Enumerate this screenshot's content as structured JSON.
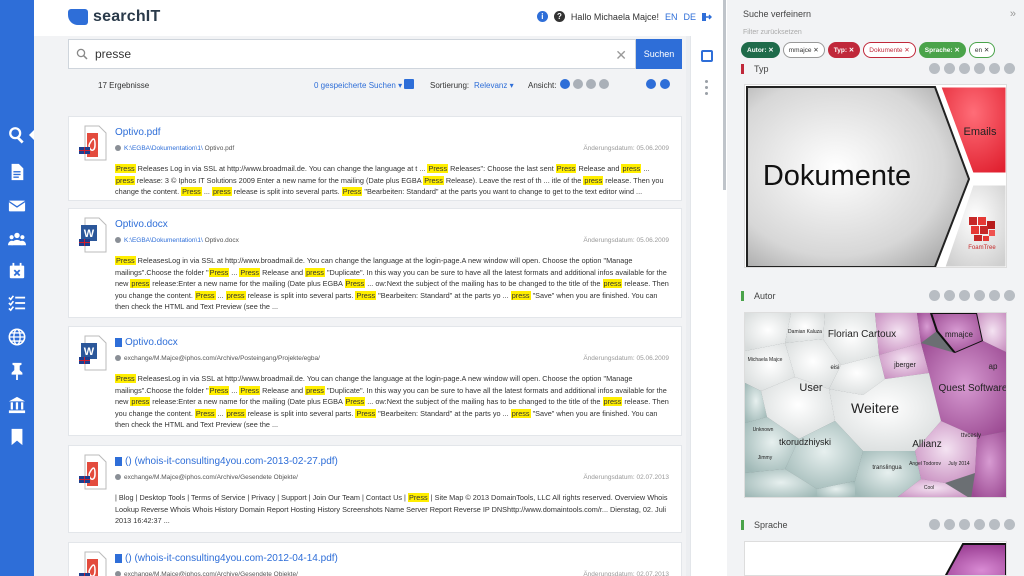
{
  "app": {
    "name": "searchIT"
  },
  "header": {
    "greeting": "Hallo Michaela Majce!",
    "lang_en": "EN",
    "lang_de": "DE",
    "info_icon": "info-icon",
    "help_icon": "help-icon",
    "logout_icon": "logout-icon"
  },
  "nav": {
    "items": [
      "search-icon",
      "document-icon",
      "mail-icon",
      "users-icon",
      "calendar-icon",
      "checklist-icon",
      "globe-icon",
      "pin-icon",
      "bank-icon",
      "bookmark-icon"
    ],
    "active_index": 0,
    "accent_color": "#2e6ed8"
  },
  "search": {
    "query": "presse",
    "button_label": "Suchen"
  },
  "results_bar": {
    "count": "17 Ergebnisse",
    "saved_searches": "0 gespeicherte Suchen",
    "sort_label": "Sortierung:",
    "sort_value": "Relevanz",
    "view_label": "Ansicht:"
  },
  "results": [
    {
      "title": "Optivo.pdf",
      "type": "pdf",
      "path_link": "K:\\EGBA\\Dokumentation\\1\\",
      "path_file": "Optivo.pdf",
      "date": "Änderungsdatum: 05.06.2009",
      "snippet": [
        [
          "m",
          "Press"
        ],
        [
          "t",
          " Releases Log in via SSL at http://www.broadmail.de. You can change the language at t ... "
        ],
        [
          "m",
          "Press"
        ],
        [
          "t",
          " Releases\": Choose the last sent "
        ],
        [
          "m",
          "Press"
        ],
        [
          "t",
          " Release and "
        ],
        [
          "m",
          "press"
        ],
        [
          "t",
          " ... "
        ],
        [
          "m",
          "press"
        ],
        [
          "t",
          " release: 3 © Iphos IT Solutions 2009 Enter a new name for the mailing (Date plus EGBA "
        ],
        [
          "m",
          "Press"
        ],
        [
          "t",
          " Release). Leave the rest of th ... itle of the "
        ],
        [
          "m",
          "press"
        ],
        [
          "t",
          " release. Then you change the content. "
        ],
        [
          "m",
          "Press"
        ],
        [
          "t",
          " ... "
        ],
        [
          "m",
          "press"
        ],
        [
          "t",
          " release is split into several parts. "
        ],
        [
          "m",
          "Press"
        ],
        [
          "t",
          " \"Bearbeiten: Standard\" at the parts you want to change to get to the text editor wind ..."
        ]
      ]
    },
    {
      "title": "Optivo.docx",
      "type": "docx",
      "path_link": "K:\\EGBA\\Dokumentation\\1\\",
      "path_file": "Optivo.docx",
      "date": "Änderungsdatum: 05.06.2009",
      "snippet": [
        [
          "m",
          "Press"
        ],
        [
          "t",
          " ReleasesLog in via SSL at http://www.broadmail.de. You can change the language at the login-page.A new window will open. Choose the option \"Manage mailings\".Choose the folder \""
        ],
        [
          "m",
          "Press"
        ],
        [
          "t",
          " ... "
        ],
        [
          "m",
          "Press"
        ],
        [
          "t",
          " Release and "
        ],
        [
          "m",
          "press"
        ],
        [
          "t",
          " \"Duplicate\". In this way you can be sure to have all the latest formats and additional infos available for the new "
        ],
        [
          "m",
          "press"
        ],
        [
          "t",
          " release:Enter a new name for the mailing (Date plus EGBA "
        ],
        [
          "m",
          "Press"
        ],
        [
          "t",
          " ... ow:Next the subject of the mailing has to be changed to the title of the "
        ],
        [
          "m",
          "press"
        ],
        [
          "t",
          " release. Then you change the content. "
        ],
        [
          "m",
          "Press"
        ],
        [
          "t",
          " ... "
        ],
        [
          "m",
          "press"
        ],
        [
          "t",
          " release is split into several parts. "
        ],
        [
          "m",
          "Press"
        ],
        [
          "t",
          " \"Bearbeiten: Standard\" at the parts yo ... "
        ],
        [
          "m",
          "press"
        ],
        [
          "t",
          " \"Save\" when you are finished. You can then check the HTML and Text Preview (see the ..."
        ]
      ]
    },
    {
      "title": "Optivo.docx",
      "type": "docx",
      "path_link": "",
      "path_file": "exchange/M.Majce@iphos.com/Archive/Posteingang/Projekte/egba/",
      "date": "Änderungsdatum: 05.06.2009",
      "snippet": [
        [
          "m",
          "Press"
        ],
        [
          "t",
          " ReleasesLog in via SSL at http://www.broadmail.de. You can change the language at the login-page.A new window will open. Choose the option \"Manage mailings\".Choose the folder \""
        ],
        [
          "m",
          "Press"
        ],
        [
          "t",
          " ... "
        ],
        [
          "m",
          "Press"
        ],
        [
          "t",
          " Release and "
        ],
        [
          "m",
          "press"
        ],
        [
          "t",
          " \"Duplicate\". In this way you can be sure to have all the latest formats and additional infos available for the new "
        ],
        [
          "m",
          "press"
        ],
        [
          "t",
          " release:Enter a new name for the mailing (Date plus EGBA "
        ],
        [
          "m",
          "Press"
        ],
        [
          "t",
          " ... ow:Next the subject of the mailing has to be changed to the title of the "
        ],
        [
          "m",
          "press"
        ],
        [
          "t",
          " release. Then you change the content. "
        ],
        [
          "m",
          "Press"
        ],
        [
          "t",
          " ... "
        ],
        [
          "m",
          "press"
        ],
        [
          "t",
          " release is split into several parts. "
        ],
        [
          "m",
          "Press"
        ],
        [
          "t",
          " \"Bearbeiten: Standard\" at the parts yo ... "
        ],
        [
          "m",
          "press"
        ],
        [
          "t",
          " \"Save\" when you are finished. You can then check the HTML and Text Preview (see the ..."
        ]
      ]
    },
    {
      "title": "() (whois-it-consulting4you.com-2013-02-27.pdf)",
      "type": "pdf",
      "path_link": "",
      "path_file": "exchange/M.Majce@iphos.com/Archive/Gesendete Objekte/",
      "date": "Änderungsdatum: 02.07.2013",
      "snippet": [
        [
          "t",
          "| Blog | Desktop Tools | Terms of Service | Privacy | Support | Join Our Team | Contact Us | "
        ],
        [
          "m",
          "Press"
        ],
        [
          "t",
          " | Site Map © 2013 DomainTools, LLC All rights reserved. Overview Whois Lookup Reverse Whois Whois History Domain Report Hosting History Screenshots Name Server Report Reverse IP DNShttp://www.domaintools.com/r... Dienstag, 02. Juli 2013 16:42:37 ..."
        ]
      ]
    },
    {
      "title": "() (whois-it-consulting4you.com-2012-04-14.pdf)",
      "type": "pdf",
      "path_link": "",
      "path_file": "exchange/M.Majce@iphos.com/Archive/Gesendete Objekte/",
      "date": "Änderungsdatum: 02.07.2013",
      "snippet": []
    }
  ],
  "facets": {
    "title": "Suche verfeinern",
    "reset": "Filter zurücksetzen",
    "chips": [
      {
        "label": "Autor: ✕",
        "style": "solid-dark"
      },
      {
        "label": "mmajce ✕",
        "style": "outline-grey"
      },
      {
        "label": "Typ: ✕",
        "style": "solid-red"
      },
      {
        "label": "Dokumente ✕",
        "style": "outline-red"
      },
      {
        "label": "Sprache: ✕",
        "style": "solid-green"
      },
      {
        "label": "en ✕",
        "style": "outline-green"
      }
    ],
    "typ": {
      "label": "Typ",
      "big": "Dokumente",
      "emails": "Emails",
      "logo_caption": "FoamTree"
    },
    "autor": {
      "label": "Autor",
      "cells": [
        "Florian Cartoux",
        "mmajce",
        "User",
        "Quest Software",
        "Weitere",
        "tkorudzhiyski",
        "Allianz",
        "jberger",
        "ap",
        "eisi",
        "Michaela Majce",
        "Damian Kaluza",
        "translingua",
        "Unknown",
        "Jimmy",
        "ttvcesly",
        "July 2014",
        "Angel Todorov",
        "Cool"
      ]
    },
    "sprache": {
      "label": "Sprache"
    }
  }
}
